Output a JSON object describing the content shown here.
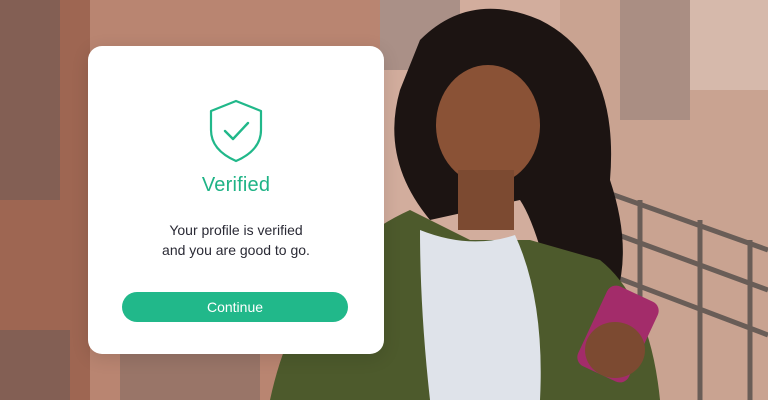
{
  "card": {
    "icon": "shield-check-icon",
    "title": "Verified",
    "message_line1": "Your profile is verified",
    "message_line2": "and you are good to go.",
    "button_label": "Continue"
  },
  "colors": {
    "accent": "#21b88a",
    "title_green": "#1fb386",
    "card_bg": "#ffffff",
    "text_dark": "#2a2a35"
  },
  "background": {
    "photo": "woman-using-phone-photo"
  }
}
